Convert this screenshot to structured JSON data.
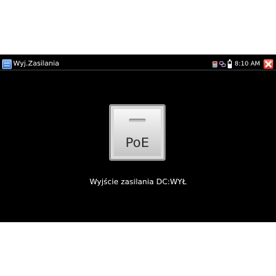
{
  "window": {
    "title": "Wyj.Zasilania",
    "app_icon": "power-app-icon"
  },
  "status_bar": {
    "icons": [
      "sd-card-icon",
      "network-link-icon",
      "battery-icon"
    ],
    "time": "8:10 AM",
    "close_icon": "close-icon"
  },
  "main": {
    "poe_button_label": "PoE",
    "status_text": "Wyjście zasilania DC:WYŁ"
  },
  "colors": {
    "background": "#000000",
    "close_button": "#d2281b",
    "text": "#ffffff"
  }
}
